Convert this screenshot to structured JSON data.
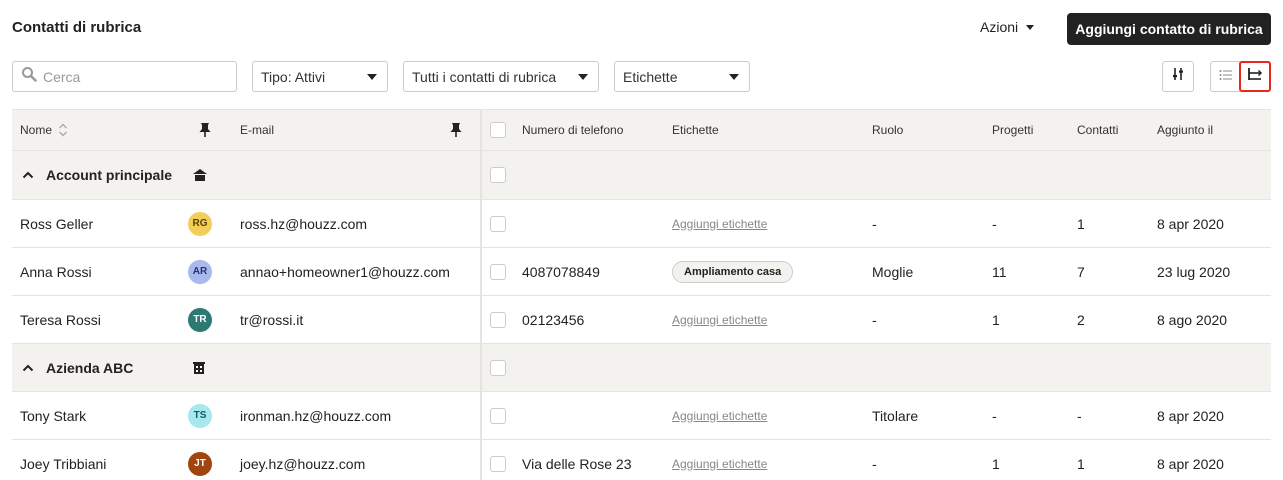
{
  "header": {
    "title": "Contatti di rubrica",
    "actions_label": "Azioni",
    "add_button_label": "Aggiungi contatto di rubrica"
  },
  "filters": {
    "search_placeholder": "Cerca",
    "type_label": "Tipo: Attivi",
    "book_label": "Tutti i contatti di rubrica",
    "tags_label": "Etichette"
  },
  "columns": {
    "name": "Nome",
    "email": "E-mail",
    "phone": "Numero di telefono",
    "tags": "Etichette",
    "role": "Ruolo",
    "projects": "Progetti",
    "contacts": "Contatti",
    "added": "Aggiunto il"
  },
  "add_tags_label": "Aggiungi etichette",
  "groups": [
    {
      "name": "Account principale",
      "rows": [
        {
          "name": "Ross Geller",
          "initials": "RG",
          "avatar_bg": "#f2cd5a",
          "avatar_fg": "#5a4300",
          "email": "ross.hz@houzz.com",
          "phone": "",
          "tag": "",
          "role": "-",
          "projects": "-",
          "contacts": "1",
          "added": "8 apr 2020"
        },
        {
          "name": "Anna Rossi",
          "initials": "AR",
          "avatar_bg": "#a9b9ee",
          "avatar_fg": "#24356e",
          "email": "annao+homeowner1@houzz.com",
          "phone": "4087078849",
          "tag": "Ampliamento casa",
          "role": "Moglie",
          "projects": "11",
          "contacts": "7",
          "added": "23 lug 2020"
        },
        {
          "name": "Teresa Rossi",
          "initials": "TR",
          "avatar_bg": "#2c7873",
          "avatar_fg": "#ffffff",
          "email": "tr@rossi.it",
          "phone": "02123456",
          "tag": "",
          "role": "-",
          "projects": "1",
          "contacts": "2",
          "added": "8 ago 2020"
        }
      ]
    },
    {
      "name": "Azienda ABC",
      "rows": [
        {
          "name": "Tony Stark",
          "initials": "TS",
          "avatar_bg": "#a6e8ee",
          "avatar_fg": "#125a62",
          "email": "ironman.hz@houzz.com",
          "phone": "",
          "tag": "",
          "role": "Titolare",
          "projects": "-",
          "contacts": "-",
          "added": "8 apr 2020"
        },
        {
          "name": "Joey Tribbiani",
          "initials": "JT",
          "avatar_bg": "#a04410",
          "avatar_fg": "#ffffff",
          "email": "joey.hz@houzz.com",
          "phone": "Via delle Rose 23",
          "tag": "",
          "role": "-",
          "projects": "1",
          "contacts": "1",
          "added": "8 apr 2020"
        }
      ]
    }
  ],
  "icons": {
    "search": "search-icon",
    "sort": "sort-icon",
    "pin": "pin-icon",
    "chevron_up": "chevron-up-icon",
    "home": "home-icon",
    "building": "building-icon",
    "filter": "filter-sliders-icon",
    "list_view": "list-view-icon",
    "columns_view": "columns-view-icon"
  },
  "colors": {
    "primary_button": "#222222",
    "header_bg": "#f4f2ee",
    "highlight": "#e8281c"
  }
}
